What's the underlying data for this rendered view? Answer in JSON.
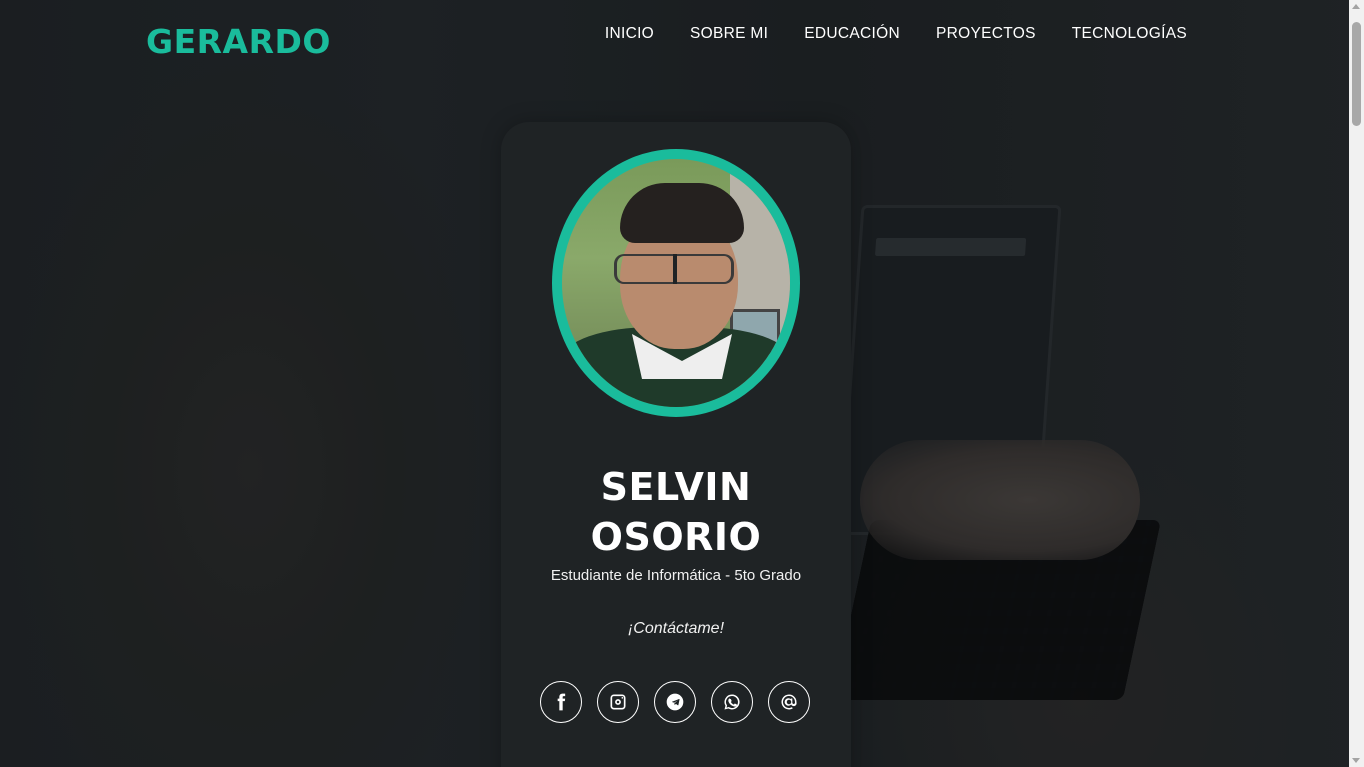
{
  "header": {
    "logo": "GERARDO",
    "nav": [
      "INICIO",
      "SOBRE MI",
      "EDUCACIÓN",
      "PROYECTOS",
      "TECNOLOGÍAS"
    ]
  },
  "profile": {
    "first_name": "SELVIN",
    "last_name": "OSORIO",
    "role": "Estudiante de Informática - 5to Grado",
    "contact_label": "¡Contáctame!"
  },
  "social_icons": [
    "facebook-icon",
    "instagram-icon",
    "telegram-icon",
    "whatsapp-icon",
    "email-icon"
  ],
  "colors": {
    "accent": "#1abc9c",
    "card_background": "#1f2325",
    "text": "#ffffff"
  }
}
